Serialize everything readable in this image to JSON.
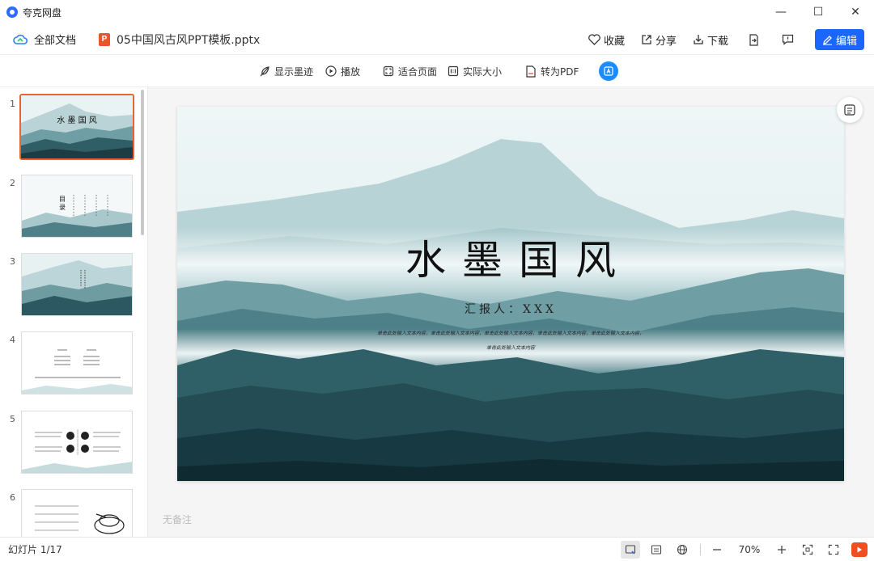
{
  "app": {
    "title": "夸克网盘",
    "accent": "#1a66ff"
  },
  "window": {
    "minimize": "—",
    "maximize": "☐",
    "close": "✕"
  },
  "docbar": {
    "all_docs": "全部文档",
    "file_name": "05中国风古风PPT模板.pptx",
    "file_badge": "P",
    "favorite": "收藏",
    "share": "分享",
    "download": "下载",
    "edit": "编辑"
  },
  "toolbar": {
    "show_ink": "显示墨迹",
    "play": "播放",
    "fit_page": "适合页面",
    "actual_size": "实际大小",
    "to_pdf": "转为PDF"
  },
  "sidebar": {
    "thumbnails": [
      {
        "num": "1",
        "active": true,
        "title": "水 墨 国 风"
      },
      {
        "num": "2",
        "active": false,
        "title": "目录"
      },
      {
        "num": "3",
        "active": false
      },
      {
        "num": "4",
        "active": false
      },
      {
        "num": "5",
        "active": false
      },
      {
        "num": "6",
        "active": false
      }
    ]
  },
  "slide": {
    "title": "水墨国风",
    "reporter": "汇报人：XXX",
    "body_line1": "单击此处输入文本内容，单击此处输入文本内容，单击此处输入文本内容，单击此处输入文本内容，单击此处输入文本内容，",
    "body_line2": "单击此处输入文本内容"
  },
  "notes_placeholder": "无备注",
  "status": {
    "slide_count": "幻灯片 1/17",
    "zoom": "70%"
  }
}
